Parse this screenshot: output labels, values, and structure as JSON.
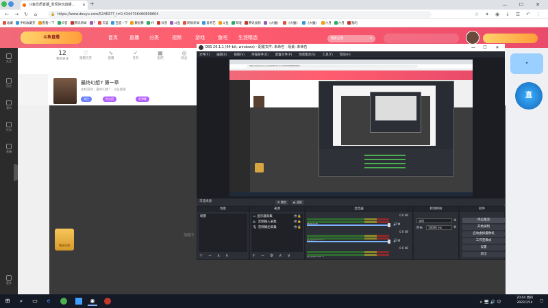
{
  "browser": {
    "tab_title": "斗鱼优质直播_发现好玩直播...",
    "new_tab": "+",
    "url": "https://www.douyu.com/5246377_t=0.4344706460809604",
    "window_min": "—",
    "window_max": "☐",
    "window_close": "✕",
    "bookmarks": [
      "收藏",
      "手机收藏夹",
      "看看一下",
      "抖音",
      "腾讯新闻",
      "1",
      "天猫",
      "百度一下",
      "聚划算",
      "yy",
      "抖音",
      "斗鱼",
      "网易新闻",
      "爱奇艺",
      "斗鱼",
      "哔哩",
      "腾讯视频",
      "《大魔》",
      "《大魔》",
      "《大魔》",
      "六月",
      "六月",
      "我的"
    ]
  },
  "douyu": {
    "logo": "斗鱼直播",
    "nav": [
      "首页",
      "直播",
      "分类",
      "视频",
      "游戏",
      "鱼吧",
      "生涯精选"
    ],
    "search_placeholder": "搜索主播",
    "sidebar": [
      "关注",
      "历史",
      "我的",
      "任务",
      "直播",
      "更多"
    ],
    "stats": [
      {
        "top": "12",
        "label": "我的关注"
      },
      {
        "top": "♡",
        "label": "观看历史"
      },
      {
        "top": "∿",
        "label": "直播"
      },
      {
        "top": "✓",
        "label": "任务"
      },
      {
        "top": "▦",
        "label": "鱼吧"
      },
      {
        "top": "◎",
        "label": "粉丝"
      },
      {
        "top": "⚙",
        "label": "设置"
      }
    ],
    "stream_title": "最终幻想7 第一章",
    "stream_sub": "主机游戏 · 最终幻想7 · 斗鱼直播",
    "pills": [
      "关注",
      "粉丝团",
      "发弹幕"
    ],
    "gift_label": "赠送礼物",
    "loading": "加载中"
  },
  "obs": {
    "title": "OBS 26.1.1 (64-bit, windows) - 配置文件: 未命名 - 场景: 未命名",
    "menu": [
      "文件(F)",
      "编辑(E)",
      "视图(V)",
      "停靠部件(D)",
      "配置文件(P)",
      "场景集合(S)",
      "工具(T)",
      "帮助(H)"
    ],
    "status": "未选择源",
    "properties_btn": "⚙ 属性",
    "filters_btn": "◐ 滤镜",
    "docks": {
      "scenes": "场景",
      "sources": "来源",
      "mixer": "混音器",
      "transitions": "转场特效",
      "controls": "控件"
    },
    "scene_items": [
      "场景"
    ],
    "source_items": [
      {
        "icon": "▭",
        "name": "显示器采集"
      },
      {
        "icon": "🔈",
        "name": "音频输入采集"
      },
      {
        "icon": "🎙",
        "name": "音频输出采集"
      }
    ],
    "mixer_channels": [
      {
        "name": "桌面音频",
        "db": "0.0 dB"
      },
      {
        "name": "麦克风/Aux 2",
        "db": "0.0 dB"
      },
      {
        "name": "麦克风/Aux 3",
        "db": "0.0 dB"
      }
    ],
    "transition_type": "淡出",
    "transition_duration_label": "时长",
    "transition_duration": "10000 ms",
    "controls": [
      "停止推流",
      "开始录制",
      "启动虚拟摄像机",
      "工作室模式",
      "设置",
      "退出"
    ],
    "dock_tools": "+ − ∧ ∨",
    "source_tools": "+ − ⚙ ∧ ∨"
  },
  "taskbar": {
    "start": "⊞",
    "search": "⌕",
    "time": "20:04 周四",
    "date": "2022/7/14",
    "tray": "∧ 🖥 🔊 中"
  }
}
